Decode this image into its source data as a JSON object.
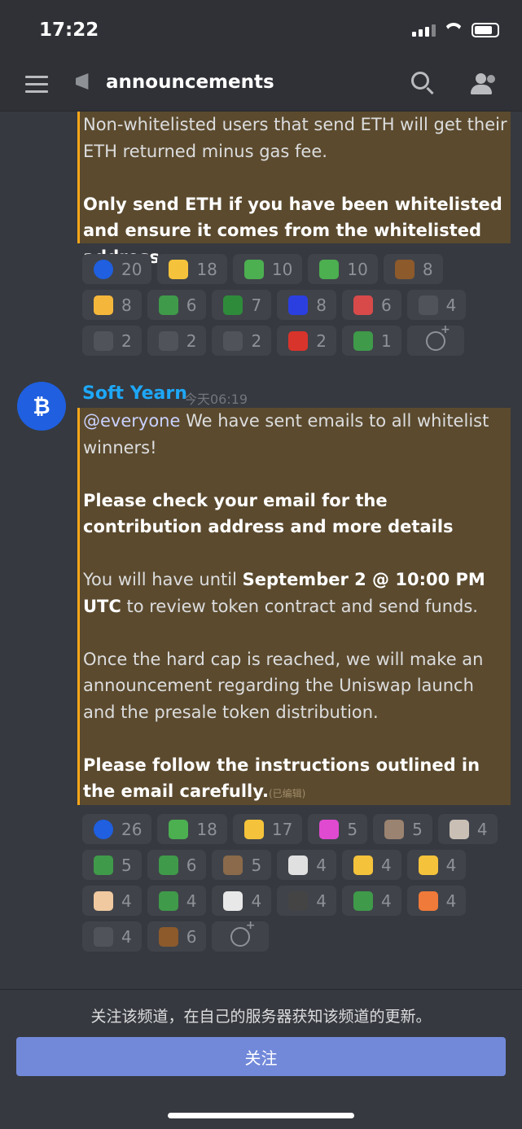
{
  "status_bar": {
    "time": "17:22"
  },
  "header": {
    "channel": "announcements",
    "icons": [
      "menu-icon",
      "megaphone-icon",
      "search-icon",
      "members-icon"
    ]
  },
  "message1": {
    "line1": "Non-whitelisted users that send ETH will get their ETH returned minus gas fee.",
    "bold": "Only send ETH if you have been whitelisted and ensure it comes from the whitelisted address.",
    "reactions": [
      {
        "emoji": "soft-yearn-logo",
        "count": "20",
        "color": "#1f5fe0"
      },
      {
        "emoji": "thumbs-up",
        "count": "18",
        "color": "#f5c33b"
      },
      {
        "emoji": "pepe-scream",
        "count": "10",
        "color": "#4caf50"
      },
      {
        "emoji": "pepe-scream-small",
        "count": "10",
        "color": "#4caf50"
      },
      {
        "emoji": "poop",
        "count": "8",
        "color": "#8d5a2b"
      },
      {
        "emoji": "disappointed-face",
        "count": "8",
        "color": "#f5b73b"
      },
      {
        "emoji": "pepe-swim",
        "count": "6",
        "color": "#3f9a4a"
      },
      {
        "emoji": "pepe-hands",
        "count": "7",
        "color": "#2e8b3a"
      },
      {
        "emoji": "bot-text",
        "count": "8",
        "color": "#2b3fe0"
      },
      {
        "emoji": "dancing-man",
        "count": "6",
        "color": "#d84a4a"
      },
      {
        "emoji": "loading-emoji",
        "count": "4",
        "color": "#50535a"
      },
      {
        "emoji": "letter-b",
        "count": "2",
        "color": "#50535a"
      },
      {
        "emoji": "letter-c",
        "count": "2",
        "color": "#50535a"
      },
      {
        "emoji": "spinner",
        "count": "2",
        "color": "#50535a"
      },
      {
        "emoji": "flag-spain",
        "count": "2",
        "color": "#d9342b"
      },
      {
        "emoji": "pepe-notification",
        "count": "1",
        "color": "#3f9a4a"
      }
    ]
  },
  "message2": {
    "author": "Soft Yearn",
    "timestamp": "今天06:19",
    "mention": "@everyone",
    "p1": " We have sent emails to all whitelist winners!",
    "p2_bold": "Please check your email for the contribution address and more details",
    "p3_a": "You will have until ",
    "p3_bold": "September 2 @ 10:00 PM UTC",
    "p3_b": " to review token contract and send funds.",
    "p4": "Once the hard cap is reached, we will make an announcement regarding the Uniswap launch and the presale token distribution.",
    "p5_bold": "Please follow the instructions outlined in the email carefully.",
    "edited": "(已编辑)",
    "reactions": [
      {
        "emoji": "soft-yearn-logo",
        "count": "26",
        "color": "#1f5fe0"
      },
      {
        "emoji": "pepe-scream",
        "count": "18",
        "color": "#4caf50"
      },
      {
        "emoji": "thumbs-up",
        "count": "17",
        "color": "#f5c33b"
      },
      {
        "emoji": "clown-pepe",
        "count": "5",
        "color": "#e04ad0"
      },
      {
        "emoji": "hamster",
        "count": "5",
        "color": "#9a8370"
      },
      {
        "emoji": "crying-cat",
        "count": "4",
        "color": "#c9bfb5"
      },
      {
        "emoji": "pepe-standing",
        "count": "5",
        "color": "#3f9a4a"
      },
      {
        "emoji": "pepe-rain",
        "count": "6",
        "color": "#3f9a4a"
      },
      {
        "emoji": "kitten",
        "count": "5",
        "color": "#8a6a4a"
      },
      {
        "emoji": "white-cat",
        "count": "4",
        "color": "#e0e0e0"
      },
      {
        "emoji": "cowboy-face",
        "count": "4",
        "color": "#f5c33b"
      },
      {
        "emoji": "cowboy-face-2",
        "count": "4",
        "color": "#f5c33b"
      },
      {
        "emoji": "bread-face",
        "count": "4",
        "color": "#f0c9a0"
      },
      {
        "emoji": "pepe-sad",
        "count": "4",
        "color": "#3f9a4a"
      },
      {
        "emoji": "cat-scream",
        "count": "4",
        "color": "#e8e8e8"
      },
      {
        "emoji": "cat-shock",
        "count": "4",
        "color": "#444"
      },
      {
        "emoji": "pepe-lay",
        "count": "4",
        "color": "#3f9a4a"
      },
      {
        "emoji": "pepe-orange",
        "count": "4",
        "color": "#f07a3a"
      },
      {
        "emoji": "letter-n",
        "count": "4",
        "color": "#50535a"
      },
      {
        "emoji": "poop",
        "count": "6",
        "color": "#8d5a2b"
      }
    ]
  },
  "footer": {
    "text": "关注该频道，在自己的服务器获知该频道的更新。",
    "button": "关注"
  }
}
